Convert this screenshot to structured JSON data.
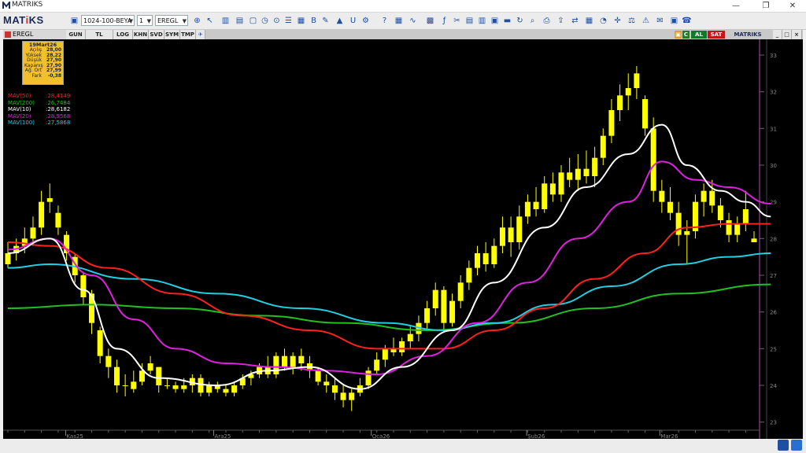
{
  "window": {
    "title": "MATRIKS"
  },
  "toolbar": {
    "brand_left": "MAT",
    "brand_right": "KS",
    "template_select": "1024-100-BEYA",
    "period_select": "1",
    "symbol_select": "EREGL"
  },
  "chart_tabs": {
    "symbol": "EREGL",
    "periods": [
      "GUN",
      "TL",
      "LOG",
      "KHN",
      "SVD",
      "SYM",
      "TMP"
    ],
    "buy_label": "AL",
    "sell_label": "SAT",
    "brand": "MATRIKS",
    "c_label": "C"
  },
  "info": {
    "date": "19Mart26",
    "rows": [
      {
        "k": "Açılış",
        "v": "28,00"
      },
      {
        "k": "Yüksek",
        "v": "28,22"
      },
      {
        "k": "Düşük",
        "v": "27,90"
      },
      {
        "k": "Kapanış",
        "v": "27,90"
      },
      {
        "k": "Ağ. Ort",
        "v": "27,99"
      },
      {
        "k": "Fark",
        "v": "-0,38"
      }
    ]
  },
  "legend": [
    {
      "k": "MAV(50)",
      "v": ":28,4149",
      "color": "#ff2020"
    },
    {
      "k": "MAV(200)",
      "v": ":26,7484",
      "color": "#22c022"
    },
    {
      "k": "MAV(10)",
      "v": ":28,6182",
      "color": "#ffffff"
    },
    {
      "k": "MAV(20)",
      "v": ":28,9568",
      "color": "#e020e0"
    },
    {
      "k": "MAV(100)",
      "v": ":27,5868",
      "color": "#20d0e0"
    }
  ],
  "chart_data": {
    "type": "candlestick",
    "y_ticks": [
      "33",
      "32",
      "31",
      "30",
      "29",
      "28",
      "27",
      "26",
      "25",
      "24",
      "23"
    ],
    "x_labels": [
      "Kas25",
      "Ara25",
      "Oca26",
      "Şub26",
      "Mar26"
    ],
    "ylim": [
      22.8,
      33.3
    ],
    "candle_color": "#ffff00",
    "candles": [
      [
        27.3,
        27.9,
        27.2,
        27.6
      ],
      [
        27.6,
        28.0,
        27.4,
        27.8
      ],
      [
        27.8,
        28.3,
        27.6,
        28.0
      ],
      [
        28.0,
        28.6,
        27.8,
        28.3
      ],
      [
        28.3,
        29.3,
        28.1,
        29.0
      ],
      [
        29.0,
        29.5,
        28.7,
        29.1
      ],
      [
        28.7,
        28.9,
        28.1,
        28.3
      ],
      [
        28.1,
        28.2,
        27.4,
        27.6
      ],
      [
        27.5,
        27.6,
        26.8,
        27.0
      ],
      [
        27.0,
        27.1,
        26.2,
        26.4
      ],
      [
        26.5,
        26.6,
        25.4,
        25.7
      ],
      [
        25.5,
        25.6,
        24.6,
        24.8
      ],
      [
        24.8,
        25.0,
        24.2,
        24.5
      ],
      [
        24.5,
        24.7,
        23.8,
        24.0
      ],
      [
        24.0,
        24.3,
        23.7,
        24.0
      ],
      [
        23.9,
        24.4,
        23.8,
        24.1
      ],
      [
        24.1,
        24.6,
        24.0,
        24.4
      ],
      [
        24.4,
        24.8,
        24.3,
        24.6
      ],
      [
        24.5,
        24.5,
        23.8,
        24.0
      ],
      [
        24.0,
        24.2,
        23.9,
        24.0
      ],
      [
        24.0,
        24.1,
        23.8,
        23.9
      ],
      [
        23.9,
        24.2,
        23.8,
        24.0
      ],
      [
        24.0,
        24.3,
        23.8,
        24.2
      ],
      [
        24.2,
        24.3,
        23.7,
        23.8
      ],
      [
        23.8,
        24.1,
        23.7,
        24.0
      ],
      [
        24.0,
        24.1,
        23.8,
        23.9
      ],
      [
        23.9,
        24.0,
        23.7,
        23.8
      ],
      [
        23.8,
        24.1,
        23.7,
        24.0
      ],
      [
        24.0,
        24.3,
        23.9,
        24.2
      ],
      [
        24.2,
        24.4,
        24.0,
        24.3
      ],
      [
        24.3,
        24.6,
        24.2,
        24.5
      ],
      [
        24.5,
        24.8,
        24.2,
        24.3
      ],
      [
        24.3,
        24.9,
        24.2,
        24.8
      ],
      [
        24.8,
        25.0,
        24.4,
        24.5
      ],
      [
        24.5,
        24.9,
        24.3,
        24.8
      ],
      [
        24.8,
        25.0,
        24.4,
        24.6
      ],
      [
        24.6,
        24.8,
        24.2,
        24.4
      ],
      [
        24.4,
        24.5,
        24.0,
        24.1
      ],
      [
        24.1,
        24.3,
        23.8,
        24.0
      ],
      [
        24.0,
        24.2,
        23.6,
        23.8
      ],
      [
        23.8,
        24.0,
        23.4,
        23.6
      ],
      [
        23.6,
        23.9,
        23.3,
        23.8
      ],
      [
        23.8,
        24.2,
        23.7,
        24.0
      ],
      [
        24.0,
        24.5,
        23.9,
        24.4
      ],
      [
        24.4,
        24.9,
        24.3,
        24.7
      ],
      [
        24.7,
        25.1,
        24.5,
        25.0
      ],
      [
        25.0,
        25.3,
        24.8,
        24.9
      ],
      [
        24.9,
        25.3,
        24.8,
        25.2
      ],
      [
        25.2,
        25.6,
        25.0,
        25.4
      ],
      [
        25.4,
        25.9,
        25.2,
        25.7
      ],
      [
        25.7,
        26.3,
        25.5,
        26.1
      ],
      [
        26.1,
        26.8,
        25.9,
        26.6
      ],
      [
        26.6,
        26.7,
        25.5,
        25.7
      ],
      [
        25.7,
        26.5,
        25.6,
        26.3
      ],
      [
        26.3,
        27.0,
        26.1,
        26.8
      ],
      [
        26.8,
        27.4,
        26.6,
        27.2
      ],
      [
        27.2,
        27.8,
        27.0,
        27.6
      ],
      [
        27.6,
        27.9,
        27.1,
        27.3
      ],
      [
        27.3,
        28.0,
        27.2,
        27.8
      ],
      [
        27.8,
        28.6,
        27.6,
        28.3
      ],
      [
        28.3,
        28.6,
        27.5,
        27.9
      ],
      [
        27.9,
        28.9,
        27.7,
        28.6
      ],
      [
        28.6,
        29.2,
        28.4,
        29.0
      ],
      [
        29.0,
        29.4,
        28.6,
        28.8
      ],
      [
        28.8,
        29.7,
        28.7,
        29.5
      ],
      [
        29.5,
        29.8,
        29.0,
        29.2
      ],
      [
        29.2,
        30.0,
        29.0,
        29.8
      ],
      [
        29.8,
        30.2,
        29.4,
        29.6
      ],
      [
        29.6,
        30.3,
        29.3,
        29.9
      ],
      [
        29.9,
        30.4,
        29.5,
        29.7
      ],
      [
        29.7,
        30.5,
        29.4,
        30.2
      ],
      [
        30.2,
        31.0,
        30.0,
        30.8
      ],
      [
        30.8,
        31.8,
        30.6,
        31.5
      ],
      [
        31.5,
        32.2,
        31.2,
        31.9
      ],
      [
        31.9,
        32.5,
        31.5,
        32.1
      ],
      [
        32.1,
        32.7,
        31.8,
        32.5
      ],
      [
        31.8,
        31.9,
        30.8,
        31.0
      ],
      [
        31.0,
        31.3,
        29.0,
        29.3
      ],
      [
        29.3,
        29.6,
        28.7,
        29.0
      ],
      [
        29.0,
        29.4,
        28.5,
        28.7
      ],
      [
        28.7,
        29.0,
        27.8,
        28.1
      ],
      [
        28.1,
        28.5,
        27.3,
        28.2
      ],
      [
        28.2,
        29.2,
        28.0,
        29.0
      ],
      [
        29.0,
        29.5,
        28.6,
        29.3
      ],
      [
        29.3,
        29.6,
        28.7,
        28.9
      ],
      [
        28.9,
        29.1,
        28.3,
        28.5
      ],
      [
        28.5,
        28.7,
        27.9,
        28.1
      ],
      [
        28.1,
        28.6,
        27.9,
        28.4
      ],
      [
        28.4,
        29.3,
        28.2,
        28.8
      ],
      [
        28.0,
        28.2,
        27.9,
        27.9
      ]
    ],
    "series": [
      {
        "name": "MAV(200)",
        "color": "#22c022",
        "values": [
          [
            0,
            26.1
          ],
          [
            10,
            26.2
          ],
          [
            20,
            26.1
          ],
          [
            30,
            25.9
          ],
          [
            40,
            25.7
          ],
          [
            50,
            25.5
          ],
          [
            60,
            25.7
          ],
          [
            70,
            26.1
          ],
          [
            80,
            26.5
          ],
          [
            91,
            26.75
          ]
        ]
      },
      {
        "name": "MAV(100)",
        "color": "#20d0e0",
        "values": [
          [
            0,
            27.2
          ],
          [
            5,
            27.3
          ],
          [
            15,
            26.9
          ],
          [
            25,
            26.5
          ],
          [
            35,
            26.1
          ],
          [
            45,
            25.7
          ],
          [
            52,
            25.5
          ],
          [
            58,
            25.7
          ],
          [
            65,
            26.2
          ],
          [
            72,
            26.7
          ],
          [
            80,
            27.3
          ],
          [
            86,
            27.5
          ],
          [
            91,
            27.6
          ]
        ]
      },
      {
        "name": "MAV(50)",
        "color": "#ff2020",
        "values": [
          [
            0,
            27.9
          ],
          [
            5,
            27.8
          ],
          [
            12,
            27.2
          ],
          [
            20,
            26.5
          ],
          [
            28,
            25.9
          ],
          [
            36,
            25.5
          ],
          [
            44,
            25.0
          ],
          [
            52,
            25.0
          ],
          [
            58,
            25.5
          ],
          [
            64,
            26.1
          ],
          [
            70,
            26.9
          ],
          [
            76,
            27.6
          ],
          [
            81,
            28.3
          ],
          [
            86,
            28.4
          ],
          [
            91,
            28.4
          ]
        ]
      },
      {
        "name": "MAV(20)",
        "color": "#e020e0",
        "values": [
          [
            0,
            27.7
          ],
          [
            5,
            28.0
          ],
          [
            10,
            27.0
          ],
          [
            15,
            25.8
          ],
          [
            20,
            25.0
          ],
          [
            26,
            24.6
          ],
          [
            32,
            24.5
          ],
          [
            38,
            24.4
          ],
          [
            44,
            24.3
          ],
          [
            50,
            24.8
          ],
          [
            56,
            25.7
          ],
          [
            62,
            26.8
          ],
          [
            68,
            28.0
          ],
          [
            74,
            29.0
          ],
          [
            78,
            30.1
          ],
          [
            82,
            29.6
          ],
          [
            86,
            29.4
          ],
          [
            91,
            28.95
          ]
        ]
      },
      {
        "name": "MAV(10)",
        "color": "#ffffff",
        "values": [
          [
            0,
            27.6
          ],
          [
            5,
            28.0
          ],
          [
            9,
            26.6
          ],
          [
            13,
            25.0
          ],
          [
            18,
            24.2
          ],
          [
            25,
            24.0
          ],
          [
            31,
            24.4
          ],
          [
            36,
            24.5
          ],
          [
            42,
            23.9
          ],
          [
            47,
            24.5
          ],
          [
            53,
            25.5
          ],
          [
            58,
            26.8
          ],
          [
            64,
            28.3
          ],
          [
            69,
            29.4
          ],
          [
            74,
            30.3
          ],
          [
            78,
            31.1
          ],
          [
            81,
            30.0
          ],
          [
            85,
            29.3
          ],
          [
            88,
            29.0
          ],
          [
            91,
            28.6
          ]
        ]
      }
    ]
  }
}
